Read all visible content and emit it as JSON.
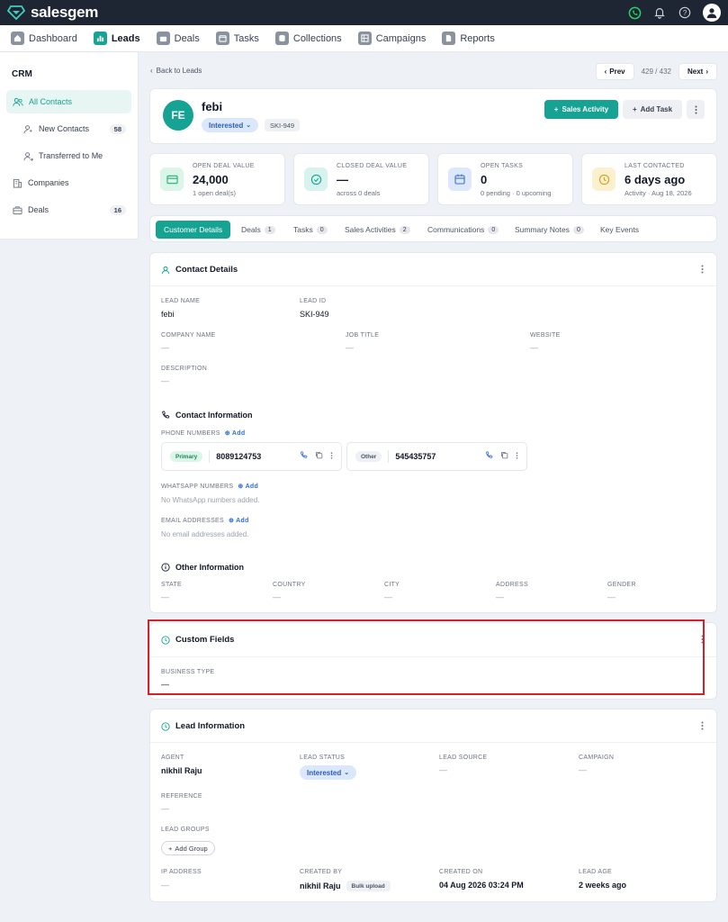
{
  "app": {
    "brand": "salesgem"
  },
  "nav": [
    {
      "label": "Dashboard",
      "icon": "dashboard-icon"
    },
    {
      "label": "Leads",
      "icon": "chart-icon",
      "active": true
    },
    {
      "label": "Deals",
      "icon": "briefcase-icon"
    },
    {
      "label": "Tasks",
      "icon": "calendar-icon"
    },
    {
      "label": "Collections",
      "icon": "database-icon"
    },
    {
      "label": "Campaigns",
      "icon": "table-icon"
    },
    {
      "label": "Reports",
      "icon": "document-icon"
    }
  ],
  "sidebar": {
    "title": "CRM",
    "items": [
      {
        "label": "All Contacts",
        "count": ""
      },
      {
        "label": "New Contacts",
        "count": "58"
      },
      {
        "label": "Transferred to Me",
        "count": ""
      },
      {
        "label": "Companies",
        "count": ""
      },
      {
        "label": "Deals",
        "count": "16"
      }
    ]
  },
  "header": {
    "back_label": "Back to Leads",
    "prev_label": "Prev",
    "next_label": "Next",
    "position": "429 / 432"
  },
  "lead": {
    "initials": "FE",
    "name": "febi",
    "status": "Interested",
    "id": "SKI-949",
    "sales_activity_label": "Sales Activity",
    "add_task_label": "Add Task"
  },
  "stats": [
    {
      "label": "OPEN DEAL VALUE",
      "value": "24,000",
      "sub": "1 open deal(s)",
      "color": "#1fb374",
      "bg": "#dcf5e9"
    },
    {
      "label": "CLOSED DEAL VALUE",
      "value": "—",
      "sub": "across 0 deals",
      "color": "#16a394",
      "bg": "#d8f3ef"
    },
    {
      "label": "OPEN TASKS",
      "value": "0",
      "sub": "0 pending  ·  0 upcoming",
      "color": "#3b6fd9",
      "bg": "#dde8fb"
    },
    {
      "label": "LAST CONTACTED",
      "value": "6 days ago",
      "sub": "Activity  ·  Aug 18, 2026",
      "color": "#d4a015",
      "bg": "#fcf1cf"
    }
  ],
  "tabs": [
    {
      "label": "Customer Details",
      "count": ""
    },
    {
      "label": "Deals",
      "count": "1"
    },
    {
      "label": "Tasks",
      "count": "0"
    },
    {
      "label": "Sales Activities",
      "count": "2"
    },
    {
      "label": "Communications",
      "count": "0"
    },
    {
      "label": "Summary Notes",
      "count": "0"
    },
    {
      "label": "Key Events",
      "count": ""
    }
  ],
  "contact": {
    "title": "Contact Details",
    "lead_name_label": "LEAD NAME",
    "lead_name": "febi",
    "lead_id_label": "LEAD ID",
    "lead_id": "SKI-949",
    "company_label": "COMPANY NAME",
    "company": "—",
    "job_label": "JOB TITLE",
    "job": "—",
    "website_label": "WEBSITE",
    "website": "—",
    "description_label": "DESCRIPTION",
    "description": "—",
    "info_title": "Contact Information",
    "phone_label": "PHONE NUMBERS",
    "add_label": "Add",
    "phones": [
      {
        "tag": "Primary",
        "number": "8089124753"
      },
      {
        "tag": "Other",
        "number": "545435757"
      }
    ],
    "whatsapp_label": "WHATSAPP NUMBERS",
    "whatsapp_empty": "No WhatsApp numbers added.",
    "email_label": "EMAIL ADDRESSES",
    "email_empty": "No email addresses added.",
    "other_title": "Other Information",
    "other": [
      {
        "label": "STATE",
        "value": "—"
      },
      {
        "label": "COUNTRY",
        "value": "—"
      },
      {
        "label": "CITY",
        "value": "—"
      },
      {
        "label": "ADDRESS",
        "value": "—"
      },
      {
        "label": "GENDER",
        "value": "—"
      }
    ]
  },
  "custom": {
    "title": "Custom Fields",
    "business_label": "BUSINESS TYPE",
    "business": "—"
  },
  "leadinfo": {
    "title": "Lead Information",
    "agent_label": "AGENT",
    "agent": "nikhil Raju",
    "status_label": "LEAD STATUS",
    "status": "Interested",
    "source_label": "LEAD SOURCE",
    "source": "—",
    "campaign_label": "CAMPAIGN",
    "campaign": "—",
    "reference_label": "REFERENCE",
    "reference": "—",
    "groups_label": "LEAD GROUPS",
    "add_group": "Add Group",
    "ip_label": "IP ADDRESS",
    "ip": "—",
    "created_by_label": "CREATED BY",
    "created_by": "nikhil Raju",
    "created_by_tag": "Bulk upload",
    "created_on_label": "CREATED ON",
    "created_on": "04 Aug 2026 03:24 PM",
    "age_label": "LEAD AGE",
    "age": "2 weeks ago"
  },
  "colors": {
    "accent": "#16a394",
    "topbar": "#1e2533",
    "highlight": "#d0222a"
  }
}
